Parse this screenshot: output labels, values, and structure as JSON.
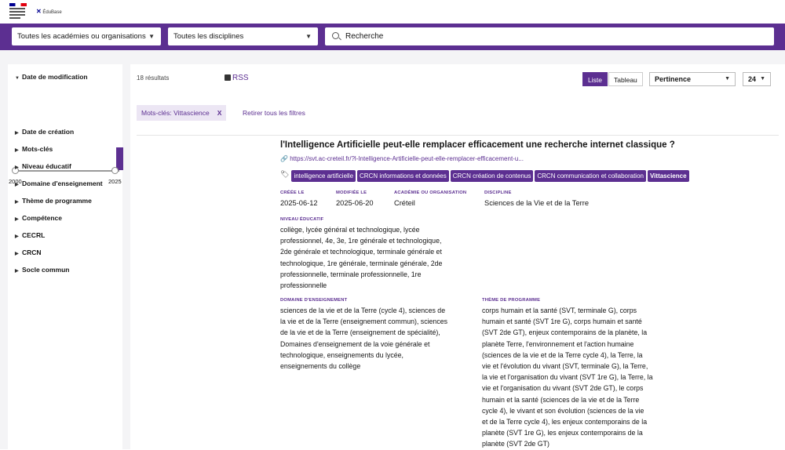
{
  "filters": {
    "academy": "Toutes les académies ou organisations",
    "discipline": "Toutes les disciplines",
    "search_value": "Recherche"
  },
  "sidebar": {
    "date_filter": {
      "label": "Date de modification",
      "min_year": "2000",
      "max_year": "2025"
    },
    "items": [
      {
        "label": "Date de création"
      },
      {
        "label": "Mots-clés"
      },
      {
        "label": "Niveau éducatif"
      },
      {
        "label": "Domaine d'enseignement"
      },
      {
        "label": "Thème de programme"
      },
      {
        "label": "Compétence"
      },
      {
        "label": "CECRL"
      },
      {
        "label": "CRCN"
      },
      {
        "label": "Socle commun"
      }
    ]
  },
  "results": {
    "count": "18 résultats",
    "rss": "RSS",
    "view_list": "Liste",
    "view_table": "Tableau",
    "sort": "Pertinence",
    "per_page": "24",
    "active_filter": "Mots-clés: Vittascience",
    "clear_filters": "Retirer tous les filtres"
  },
  "item": {
    "title": "l'Intelligence Artificielle peut-elle remplacer efficacement une recherche internet classique ?",
    "url": "https://svt.ac-creteil.fr/?l-Intelligence-Artificielle-peut-elle-remplacer-efficacement-u...",
    "tags": [
      "intelligence artificielle",
      "CRCN informations et données",
      "CRCN création de contenus",
      "CRCN communication et collaboration",
      "Vittascience"
    ],
    "created_label": "CRÉÉE LE",
    "created": "2025-06-12",
    "modified_label": "MODIFIÉE LE",
    "modified": "2025-06-20",
    "academy_label": "ACADÉMIE OU ORGANISATION",
    "academy": "Créteil",
    "discipline_label": "DISCIPLINE",
    "discipline": "Sciences de la Vie et de la Terre",
    "level_label": "NIVEAU ÉDUCATIF",
    "level": "collège, lycée général et technologique, lycée\nprofessionnel, 4e, 3e, 1re générale et technologique,\n2de générale et technologique, terminale générale et\ntechnologique, 1re générale, terminale générale, 2de\nprofessionnelle, terminale professionnelle, 1re\nprofessionnelle",
    "domain_label": "DOMAINE D'ENSEIGNEMENT",
    "domain": "sciences de la vie et de la Terre (cycle 4), sciences de\nla vie et de la Terre (enseignement commun), sciences\nde la vie et de la Terre (enseignement de spécialité),\nDomaines d'enseignement de la voie générale et\ntechnologique, enseignements du lycée,\nenseignements du collège",
    "theme_label": "THÈME DE PROGRAMME",
    "theme": "corps humain et la santé (SVT, terminale G), corps\nhumain et santé (SVT 1re G), corps humain et santé\n(SVT 2de GT), enjeux contemporains de la planète, la\nplanète Terre, l'environnement et l'action humaine\n(sciences de la vie et de la Terre cycle 4), la Terre, la\nvie et l'évolution du vivant (SVT, terminale G), la Terre,\nla vie et l'organisation du vivant (SVT 1re G), la Terre, la\nvie et l'organisation du vivant (SVT 2de GT), le corps\nhumain et la santé (sciences de la vie et de la Terre\ncycle 4), le vivant et son évolution (sciences de la vie\net de la Terre cycle 4), les enjeux contemporains de la\nplanète (SVT 1re G), les enjeux contemporains de la\nplanète (SVT 2de GT)"
  }
}
